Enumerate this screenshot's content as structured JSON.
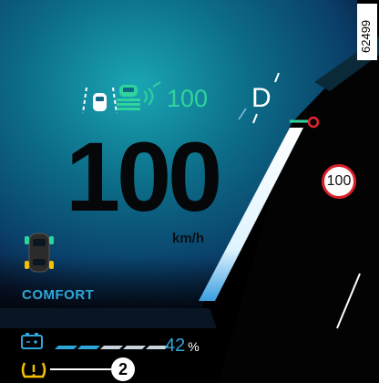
{
  "cluster": {
    "speed": "100",
    "speed_unit": "km/h",
    "acc_set_speed": "100",
    "gear": "D",
    "speed_limit": "100",
    "drive_mode": "COMFORT",
    "charge_percent": "42",
    "charge_unit": "%",
    "charge_fraction": 0.42,
    "callout_number": "2",
    "reference_code": "62499"
  },
  "icons": [
    "lane-keep-icon",
    "adaptive-cruise-icon",
    "car-topview-icon",
    "battery-icon",
    "tire-pressure-warning-icon"
  ],
  "colors": {
    "background_top": "#0f6f86",
    "accent_green": "#2fd39c",
    "accent_blue": "#2fa6d9",
    "warning_yellow": "#f2c000",
    "limit_red": "#d8202a"
  }
}
